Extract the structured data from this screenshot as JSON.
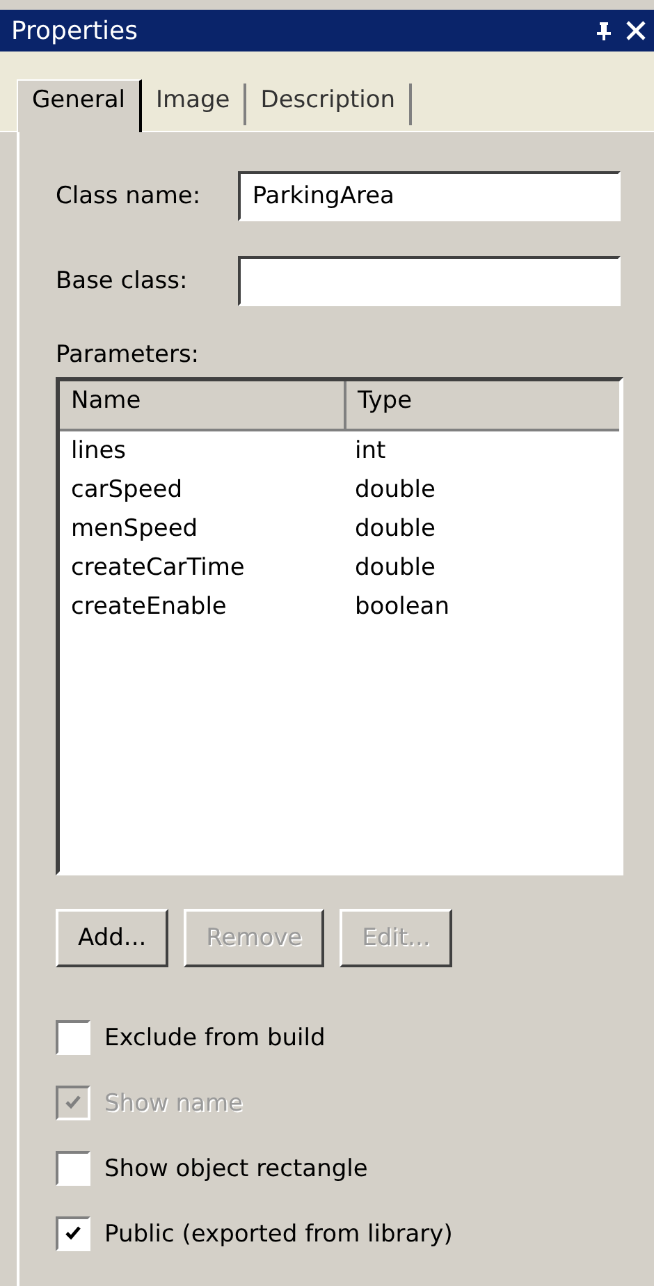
{
  "window": {
    "title": "Properties"
  },
  "tabs": [
    {
      "label": "General",
      "selected": true
    },
    {
      "label": "Image",
      "selected": false
    },
    {
      "label": "Description",
      "selected": false
    }
  ],
  "class_name": {
    "label": "Class name:",
    "value": "ParkingArea"
  },
  "base_class": {
    "label": "Base class:"
  },
  "parameters": {
    "label": "Parameters:",
    "columns": [
      "Name",
      "Type"
    ],
    "rows": [
      [
        "lines",
        "int"
      ],
      [
        "carSpeed",
        "double"
      ],
      [
        "menSpeed",
        "double"
      ],
      [
        "createCarTime",
        "double"
      ],
      [
        "createEnable",
        "boolean"
      ]
    ]
  },
  "buttons": [
    {
      "label": "Add...",
      "disabled": false
    },
    {
      "label": "Remove",
      "disabled": true
    },
    {
      "label": "Edit...",
      "disabled": true
    }
  ],
  "options": [
    {
      "label": "Exclude from build",
      "checked": false,
      "disabled": false
    },
    {
      "label": "Show name",
      "checked": true,
      "disabled": true
    },
    {
      "label": "Show object rectangle",
      "checked": false,
      "disabled": false
    },
    {
      "label": "Public (exported from library)",
      "checked": true,
      "disabled": false
    }
  ]
}
